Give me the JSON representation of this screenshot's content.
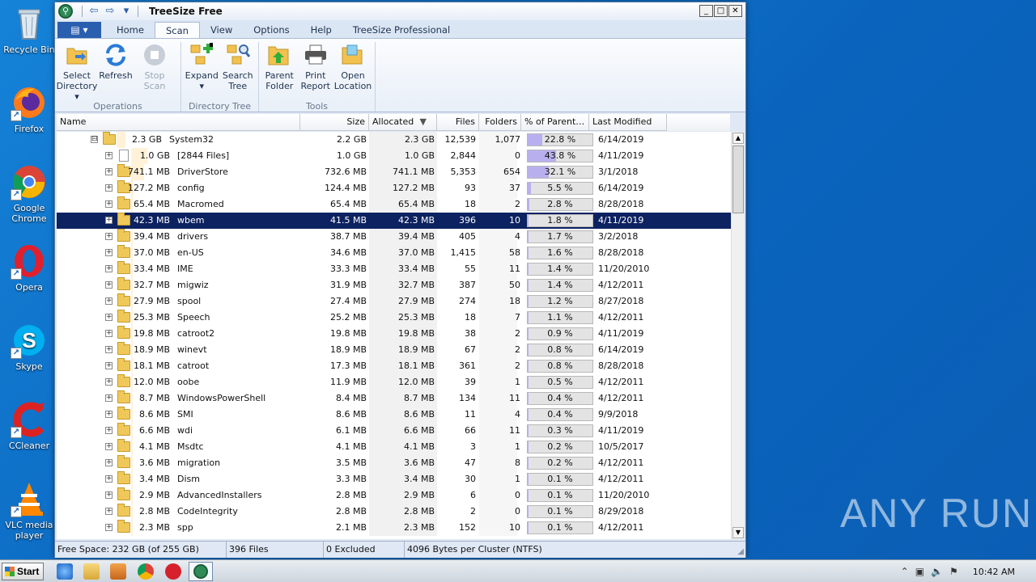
{
  "desktop": {
    "icons": [
      {
        "label": "Recycle Bin"
      },
      {
        "label": "Firefox"
      },
      {
        "label": "Google Chrome"
      },
      {
        "label": "Opera"
      },
      {
        "label": "Skype"
      },
      {
        "label": "CCleaner"
      },
      {
        "label": "VLC media player"
      }
    ],
    "watermark": "ANY RUN"
  },
  "window": {
    "title": "TreeSize Free",
    "controls": {
      "minimize": "_",
      "maximize": "□",
      "close": "✕"
    },
    "qat": {
      "back": "⇦",
      "forward": "⇨",
      "dropdown": "▾"
    },
    "tabs": [
      "Home",
      "Scan",
      "View",
      "Options",
      "Help",
      "TreeSize Professional"
    ],
    "active_tab": "Scan",
    "file_tab_glyph": "▤ ▾"
  },
  "ribbon": {
    "groups": [
      {
        "label": "Operations",
        "buttons": [
          {
            "label": "Select Directory ▾",
            "icon": "folder-arrow-icon"
          },
          {
            "label": "Refresh",
            "icon": "refresh-icon"
          },
          {
            "label": "Stop Scan",
            "icon": "stop-icon",
            "disabled": true
          }
        ]
      },
      {
        "label": "Directory Tree",
        "buttons": [
          {
            "label": "Expand ▾",
            "icon": "expand-icon"
          },
          {
            "label": "Search Tree",
            "icon": "search-tree-icon"
          }
        ]
      },
      {
        "label": "Tools",
        "buttons": [
          {
            "label": "Parent Folder",
            "icon": "parent-folder-icon"
          },
          {
            "label": "Print Report",
            "icon": "printer-icon"
          },
          {
            "label": "Open Location",
            "icon": "open-folder-icon"
          }
        ]
      }
    ]
  },
  "grid": {
    "columns": [
      "Name",
      "Size",
      "Allocated",
      "Files",
      "Folders",
      "% of Parent…",
      "Last Modified"
    ],
    "sort_indicator": "▼",
    "rows": [
      {
        "block": "2.3 GB",
        "name": "System32",
        "size": "2.2 GB",
        "allocated": "2.3 GB",
        "files": "12,539",
        "folders": "1,077",
        "pct": 22.8,
        "pct_label": "22.8 %",
        "modified": "6/14/2019",
        "level": 0,
        "kind": "folder",
        "expander": "⊟"
      },
      {
        "block": "1.0 GB",
        "name": "[2844 Files]",
        "size": "1.0 GB",
        "allocated": "1.0 GB",
        "files": "2,844",
        "folders": "0",
        "pct": 43.8,
        "pct_label": "43.8 %",
        "modified": "4/11/2019",
        "level": 1,
        "kind": "file",
        "expander": "+"
      },
      {
        "block": "741.1 MB",
        "name": "DriverStore",
        "size": "732.6 MB",
        "allocated": "741.1 MB",
        "files": "5,353",
        "folders": "654",
        "pct": 32.1,
        "pct_label": "32.1 %",
        "modified": "3/1/2018",
        "level": 1,
        "kind": "folder",
        "expander": "+"
      },
      {
        "block": "127.2 MB",
        "name": "config",
        "size": "124.4 MB",
        "allocated": "127.2 MB",
        "files": "93",
        "folders": "37",
        "pct": 5.5,
        "pct_label": "5.5 %",
        "modified": "6/14/2019",
        "level": 1,
        "kind": "folder",
        "expander": "+"
      },
      {
        "block": "65.4 MB",
        "name": "Macromed",
        "size": "65.4 MB",
        "allocated": "65.4 MB",
        "files": "18",
        "folders": "2",
        "pct": 2.8,
        "pct_label": "2.8 %",
        "modified": "8/28/2018",
        "level": 1,
        "kind": "folder",
        "expander": "+"
      },
      {
        "block": "42.3 MB",
        "name": "wbem",
        "size": "41.5 MB",
        "allocated": "42.3 MB",
        "files": "396",
        "folders": "10",
        "pct": 1.8,
        "pct_label": "1.8 %",
        "modified": "4/11/2019",
        "level": 1,
        "kind": "folder",
        "expander": "+",
        "selected": true
      },
      {
        "block": "39.4 MB",
        "name": "drivers",
        "size": "38.7 MB",
        "allocated": "39.4 MB",
        "files": "405",
        "folders": "4",
        "pct": 1.7,
        "pct_label": "1.7 %",
        "modified": "3/2/2018",
        "level": 1,
        "kind": "folder",
        "expander": "+"
      },
      {
        "block": "37.0 MB",
        "name": "en-US",
        "size": "34.6 MB",
        "allocated": "37.0 MB",
        "files": "1,415",
        "folders": "58",
        "pct": 1.6,
        "pct_label": "1.6 %",
        "modified": "8/28/2018",
        "level": 1,
        "kind": "folder",
        "expander": "+"
      },
      {
        "block": "33.4 MB",
        "name": "IME",
        "size": "33.3 MB",
        "allocated": "33.4 MB",
        "files": "55",
        "folders": "11",
        "pct": 1.4,
        "pct_label": "1.4 %",
        "modified": "11/20/2010",
        "level": 1,
        "kind": "folder",
        "expander": "+"
      },
      {
        "block": "32.7 MB",
        "name": "migwiz",
        "size": "31.9 MB",
        "allocated": "32.7 MB",
        "files": "387",
        "folders": "50",
        "pct": 1.4,
        "pct_label": "1.4 %",
        "modified": "4/12/2011",
        "level": 1,
        "kind": "folder",
        "expander": "+"
      },
      {
        "block": "27.9 MB",
        "name": "spool",
        "size": "27.4 MB",
        "allocated": "27.9 MB",
        "files": "274",
        "folders": "18",
        "pct": 1.2,
        "pct_label": "1.2 %",
        "modified": "8/27/2018",
        "level": 1,
        "kind": "folder",
        "expander": "+"
      },
      {
        "block": "25.3 MB",
        "name": "Speech",
        "size": "25.2 MB",
        "allocated": "25.3 MB",
        "files": "18",
        "folders": "7",
        "pct": 1.1,
        "pct_label": "1.1 %",
        "modified": "4/12/2011",
        "level": 1,
        "kind": "folder",
        "expander": "+"
      },
      {
        "block": "19.8 MB",
        "name": "catroot2",
        "size": "19.8 MB",
        "allocated": "19.8 MB",
        "files": "38",
        "folders": "2",
        "pct": 0.9,
        "pct_label": "0.9 %",
        "modified": "4/11/2019",
        "level": 1,
        "kind": "folder",
        "expander": "+"
      },
      {
        "block": "18.9 MB",
        "name": "winevt",
        "size": "18.9 MB",
        "allocated": "18.9 MB",
        "files": "67",
        "folders": "2",
        "pct": 0.8,
        "pct_label": "0.8 %",
        "modified": "6/14/2019",
        "level": 1,
        "kind": "folder",
        "expander": "+"
      },
      {
        "block": "18.1 MB",
        "name": "catroot",
        "size": "17.3 MB",
        "allocated": "18.1 MB",
        "files": "361",
        "folders": "2",
        "pct": 0.8,
        "pct_label": "0.8 %",
        "modified": "8/28/2018",
        "level": 1,
        "kind": "folder",
        "expander": "+"
      },
      {
        "block": "12.0 MB",
        "name": "oobe",
        "size": "11.9 MB",
        "allocated": "12.0 MB",
        "files": "39",
        "folders": "1",
        "pct": 0.5,
        "pct_label": "0.5 %",
        "modified": "4/12/2011",
        "level": 1,
        "kind": "folder",
        "expander": "+"
      },
      {
        "block": "8.7 MB",
        "name": "WindowsPowerShell",
        "size": "8.4 MB",
        "allocated": "8.7 MB",
        "files": "134",
        "folders": "11",
        "pct": 0.4,
        "pct_label": "0.4 %",
        "modified": "4/12/2011",
        "level": 1,
        "kind": "folder",
        "expander": "+"
      },
      {
        "block": "8.6 MB",
        "name": "SMI",
        "size": "8.6 MB",
        "allocated": "8.6 MB",
        "files": "11",
        "folders": "4",
        "pct": 0.4,
        "pct_label": "0.4 %",
        "modified": "9/9/2018",
        "level": 1,
        "kind": "folder",
        "expander": "+"
      },
      {
        "block": "6.6 MB",
        "name": "wdi",
        "size": "6.1 MB",
        "allocated": "6.6 MB",
        "files": "66",
        "folders": "11",
        "pct": 0.3,
        "pct_label": "0.3 %",
        "modified": "4/11/2019",
        "level": 1,
        "kind": "folder",
        "expander": "+"
      },
      {
        "block": "4.1 MB",
        "name": "Msdtc",
        "size": "4.1 MB",
        "allocated": "4.1 MB",
        "files": "3",
        "folders": "1",
        "pct": 0.2,
        "pct_label": "0.2 %",
        "modified": "10/5/2017",
        "level": 1,
        "kind": "folder",
        "expander": "+"
      },
      {
        "block": "3.6 MB",
        "name": "migration",
        "size": "3.5 MB",
        "allocated": "3.6 MB",
        "files": "47",
        "folders": "8",
        "pct": 0.2,
        "pct_label": "0.2 %",
        "modified": "4/12/2011",
        "level": 1,
        "kind": "folder",
        "expander": "+"
      },
      {
        "block": "3.4 MB",
        "name": "Dism",
        "size": "3.3 MB",
        "allocated": "3.4 MB",
        "files": "30",
        "folders": "1",
        "pct": 0.1,
        "pct_label": "0.1 %",
        "modified": "4/12/2011",
        "level": 1,
        "kind": "folder",
        "expander": "+"
      },
      {
        "block": "2.9 MB",
        "name": "AdvancedInstallers",
        "size": "2.8 MB",
        "allocated": "2.9 MB",
        "files": "6",
        "folders": "0",
        "pct": 0.1,
        "pct_label": "0.1 %",
        "modified": "11/20/2010",
        "level": 1,
        "kind": "folder",
        "expander": "+"
      },
      {
        "block": "2.8 MB",
        "name": "CodeIntegrity",
        "size": "2.8 MB",
        "allocated": "2.8 MB",
        "files": "2",
        "folders": "0",
        "pct": 0.1,
        "pct_label": "0.1 %",
        "modified": "8/29/2018",
        "level": 1,
        "kind": "folder",
        "expander": "+"
      },
      {
        "block": "2.3 MB",
        "name": "spp",
        "size": "2.1 MB",
        "allocated": "2.3 MB",
        "files": "152",
        "folders": "10",
        "pct": 0.1,
        "pct_label": "0.1 %",
        "modified": "4/12/2011",
        "level": 1,
        "kind": "folder",
        "expander": "+"
      }
    ]
  },
  "statusbar": {
    "free_space": "Free Space: 232 GB  (of 255 GB)",
    "files": "396  Files",
    "excluded": "0 Excluded",
    "cluster": "4096  Bytes per Cluster (NTFS)"
  },
  "taskbar": {
    "start_label": "Start",
    "clock": "10:42 AM",
    "tray_icons": [
      "⌃",
      "▣",
      "🔈",
      "⚑"
    ]
  },
  "colors": {
    "selection": "#0d2260",
    "pct_fill": "#b8b0ee",
    "ribbon_file_tab": "#2a5fb0"
  }
}
